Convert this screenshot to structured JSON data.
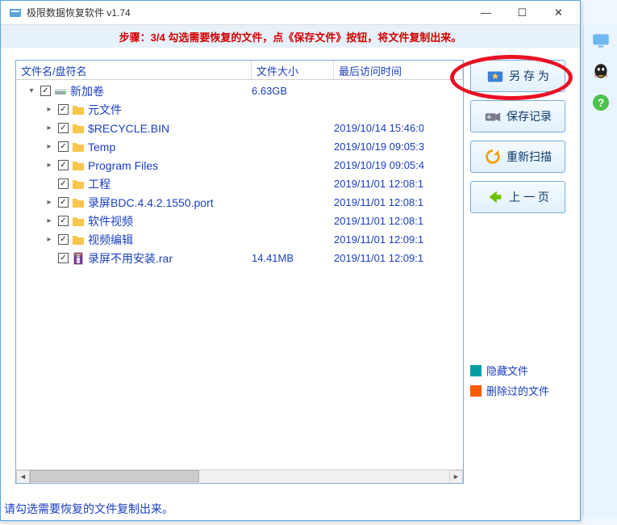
{
  "window": {
    "title": "极限数据恢复软件 v1.74"
  },
  "banner": "步骤：3/4 勾选需要恢复的文件，点《保存文件》按钮，将文件复制出来。",
  "columns": {
    "name": "文件名/盘符名",
    "size": "文件大小",
    "date": "最后访问时间"
  },
  "tree": [
    {
      "depth": 0,
      "expander": "▾",
      "checked": true,
      "icon": "drive",
      "label": "新加卷",
      "size": "6.63GB",
      "date": ""
    },
    {
      "depth": 1,
      "expander": "▸",
      "checked": true,
      "icon": "folder",
      "label": "元文件",
      "size": "",
      "date": ""
    },
    {
      "depth": 1,
      "expander": "▸",
      "checked": true,
      "icon": "folder",
      "label": "$RECYCLE.BIN",
      "size": "",
      "date": "2019/10/14 15:46:0"
    },
    {
      "depth": 1,
      "expander": "▸",
      "checked": true,
      "icon": "folder",
      "label": "Temp",
      "size": "",
      "date": "2019/10/19 09:05:3"
    },
    {
      "depth": 1,
      "expander": "▸",
      "checked": true,
      "icon": "folder",
      "label": "Program Files",
      "size": "",
      "date": "2019/10/19 09:05:4"
    },
    {
      "depth": 1,
      "expander": "",
      "checked": true,
      "icon": "folder",
      "label": "工程",
      "size": "",
      "date": "2019/11/01 12:08:1"
    },
    {
      "depth": 1,
      "expander": "▸",
      "checked": true,
      "icon": "folder",
      "label": "录屏BDC.4.4.2.1550.port",
      "size": "",
      "date": "2019/11/01 12:08:1"
    },
    {
      "depth": 1,
      "expander": "▸",
      "checked": true,
      "icon": "folder",
      "label": "软件视频",
      "size": "",
      "date": "2019/11/01 12:08:1"
    },
    {
      "depth": 1,
      "expander": "▸",
      "checked": true,
      "icon": "folder",
      "label": "视频编辑",
      "size": "",
      "date": "2019/11/01 12:09:1"
    },
    {
      "depth": 1,
      "expander": "",
      "checked": true,
      "icon": "rar",
      "label": "录屏不用安装.rar",
      "size": "14.41MB",
      "date": "2019/11/01 12:09:1"
    }
  ],
  "buttons": {
    "save_as": "另 存 为",
    "save_record": "保存记录",
    "rescan": "重新扫描",
    "prev": "上 一 页"
  },
  "legend": {
    "hidden": "隐藏文件",
    "deleted": "删除过的文件",
    "hidden_color": "#00a0a0",
    "deleted_color": "#ff5a00"
  },
  "status": "请勾选需要恢复的文件复制出来。"
}
